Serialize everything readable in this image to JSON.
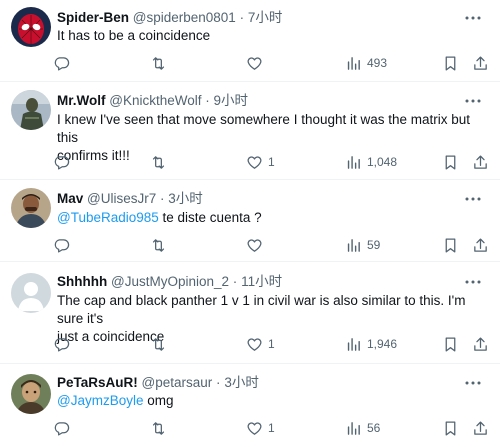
{
  "tweets": [
    {
      "name": "Spider-Ben",
      "handle": "@spiderben0801",
      "dot": "·",
      "time": "7小时",
      "mention": "",
      "text": "It has to be a coincidence",
      "text2": "",
      "replies": "",
      "retweets": "",
      "likes": "",
      "views": "493",
      "avatar_icon": "spiderman-avatar"
    },
    {
      "name": "Mr.Wolf",
      "handle": "@KnicktheWolf",
      "dot": "·",
      "time": "9小时",
      "mention": "",
      "text": "I knew I've seen that move somewhere I thought it was the matrix but this",
      "text2": "confirms it!!!",
      "replies": "",
      "retweets": "",
      "likes": "1",
      "views": "1,048",
      "avatar_icon": "armored-figure-avatar"
    },
    {
      "name": "Mav",
      "handle": "@UlisesJr7",
      "dot": "·",
      "time": "3小时",
      "mention": "@TubeRadio985",
      "text": " te diste cuenta ?",
      "text2": "",
      "replies": "",
      "retweets": "",
      "likes": "",
      "views": "59",
      "avatar_icon": "person-photo-avatar"
    },
    {
      "name": "Shhhhh",
      "handle": "@JustMyOpinion_2",
      "dot": "·",
      "time": "11小时",
      "mention": "",
      "text": "The cap and black panther 1 v 1 in civil war is also similar to this. I'm sure it's",
      "text2": "just a coincidence",
      "replies": "",
      "retweets": "",
      "likes": "1",
      "views": "1,946",
      "avatar_icon": "default-user-avatar"
    },
    {
      "name": "PeTaRsAuR!",
      "handle": "@petarsaur",
      "dot": "·",
      "time": "3小时",
      "mention": "@JaymzBoyle",
      "text": " omg",
      "text2": "",
      "replies": "",
      "retweets": "",
      "likes": "1",
      "views": "56",
      "avatar_icon": "character-avatar"
    }
  ],
  "colors": {
    "accent": "#1d9bf0",
    "secondary_text": "#536471",
    "divider": "#eff3f4"
  }
}
